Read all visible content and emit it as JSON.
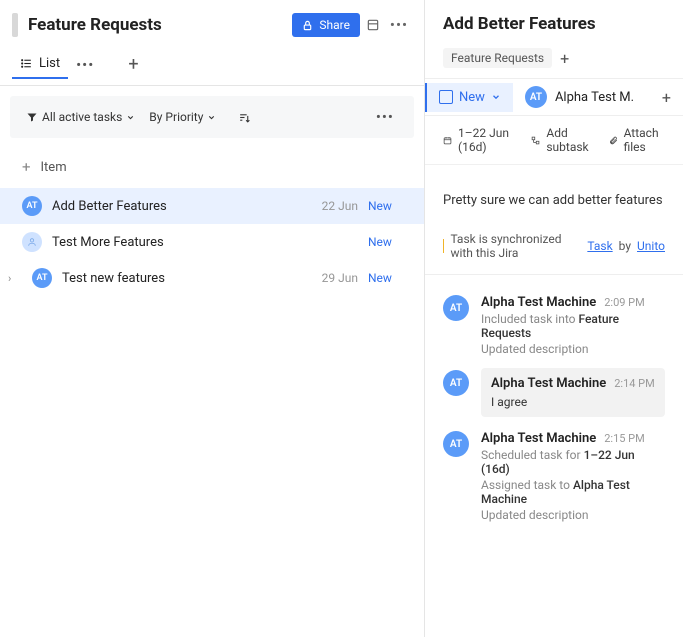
{
  "left": {
    "title": "Feature Requests",
    "share": "Share",
    "view_label": "List",
    "filters": {
      "all_tasks": "All active tasks",
      "by_priority": "By Priority"
    },
    "add_item": "Item",
    "tasks": [
      {
        "avatar": "AT",
        "title": "Add Better Features",
        "date": "22 Jun",
        "status": "New",
        "selected": true,
        "avatar_dim": false,
        "has_chevron": false
      },
      {
        "avatar": "",
        "title": "Test More Features",
        "date": "",
        "status": "New",
        "selected": false,
        "avatar_dim": true,
        "has_chevron": false
      },
      {
        "avatar": "AT",
        "title": "Test new features",
        "date": "29 Jun",
        "status": "New",
        "selected": false,
        "avatar_dim": false,
        "has_chevron": true
      }
    ]
  },
  "right": {
    "title": "Add Better Features",
    "crumb": "Feature Requests",
    "status_label": "New",
    "assignee": {
      "initials": "AT",
      "name": "Alpha Test M."
    },
    "date_range": "1–22 Jun (16d)",
    "add_subtask": "Add subtask",
    "attach": "Attach files",
    "description": "Pretty sure we can add better features",
    "sync": {
      "pre": "Task is synchronized with this Jira",
      "task_link": "Task",
      "mid": "by",
      "unito_link": "Unito"
    },
    "activity": [
      {
        "type": "event",
        "initials": "AT",
        "author": "Alpha Test Machine",
        "time": "2:09 PM",
        "lines": [
          {
            "pre": "Included task into ",
            "bold": "Feature Requests"
          },
          {
            "pre": "Updated description",
            "bold": ""
          }
        ]
      },
      {
        "type": "comment",
        "initials": "AT",
        "author": "Alpha Test Machine",
        "time": "2:14 PM",
        "text": "I agree"
      },
      {
        "type": "event",
        "initials": "AT",
        "author": "Alpha Test Machine",
        "time": "2:15 PM",
        "lines": [
          {
            "pre": "Scheduled task for ",
            "bold": "1–22 Jun (16d)"
          },
          {
            "pre": "Assigned task to ",
            "bold": "Alpha Test Machine"
          },
          {
            "pre": "Updated description",
            "bold": ""
          }
        ]
      }
    ]
  }
}
